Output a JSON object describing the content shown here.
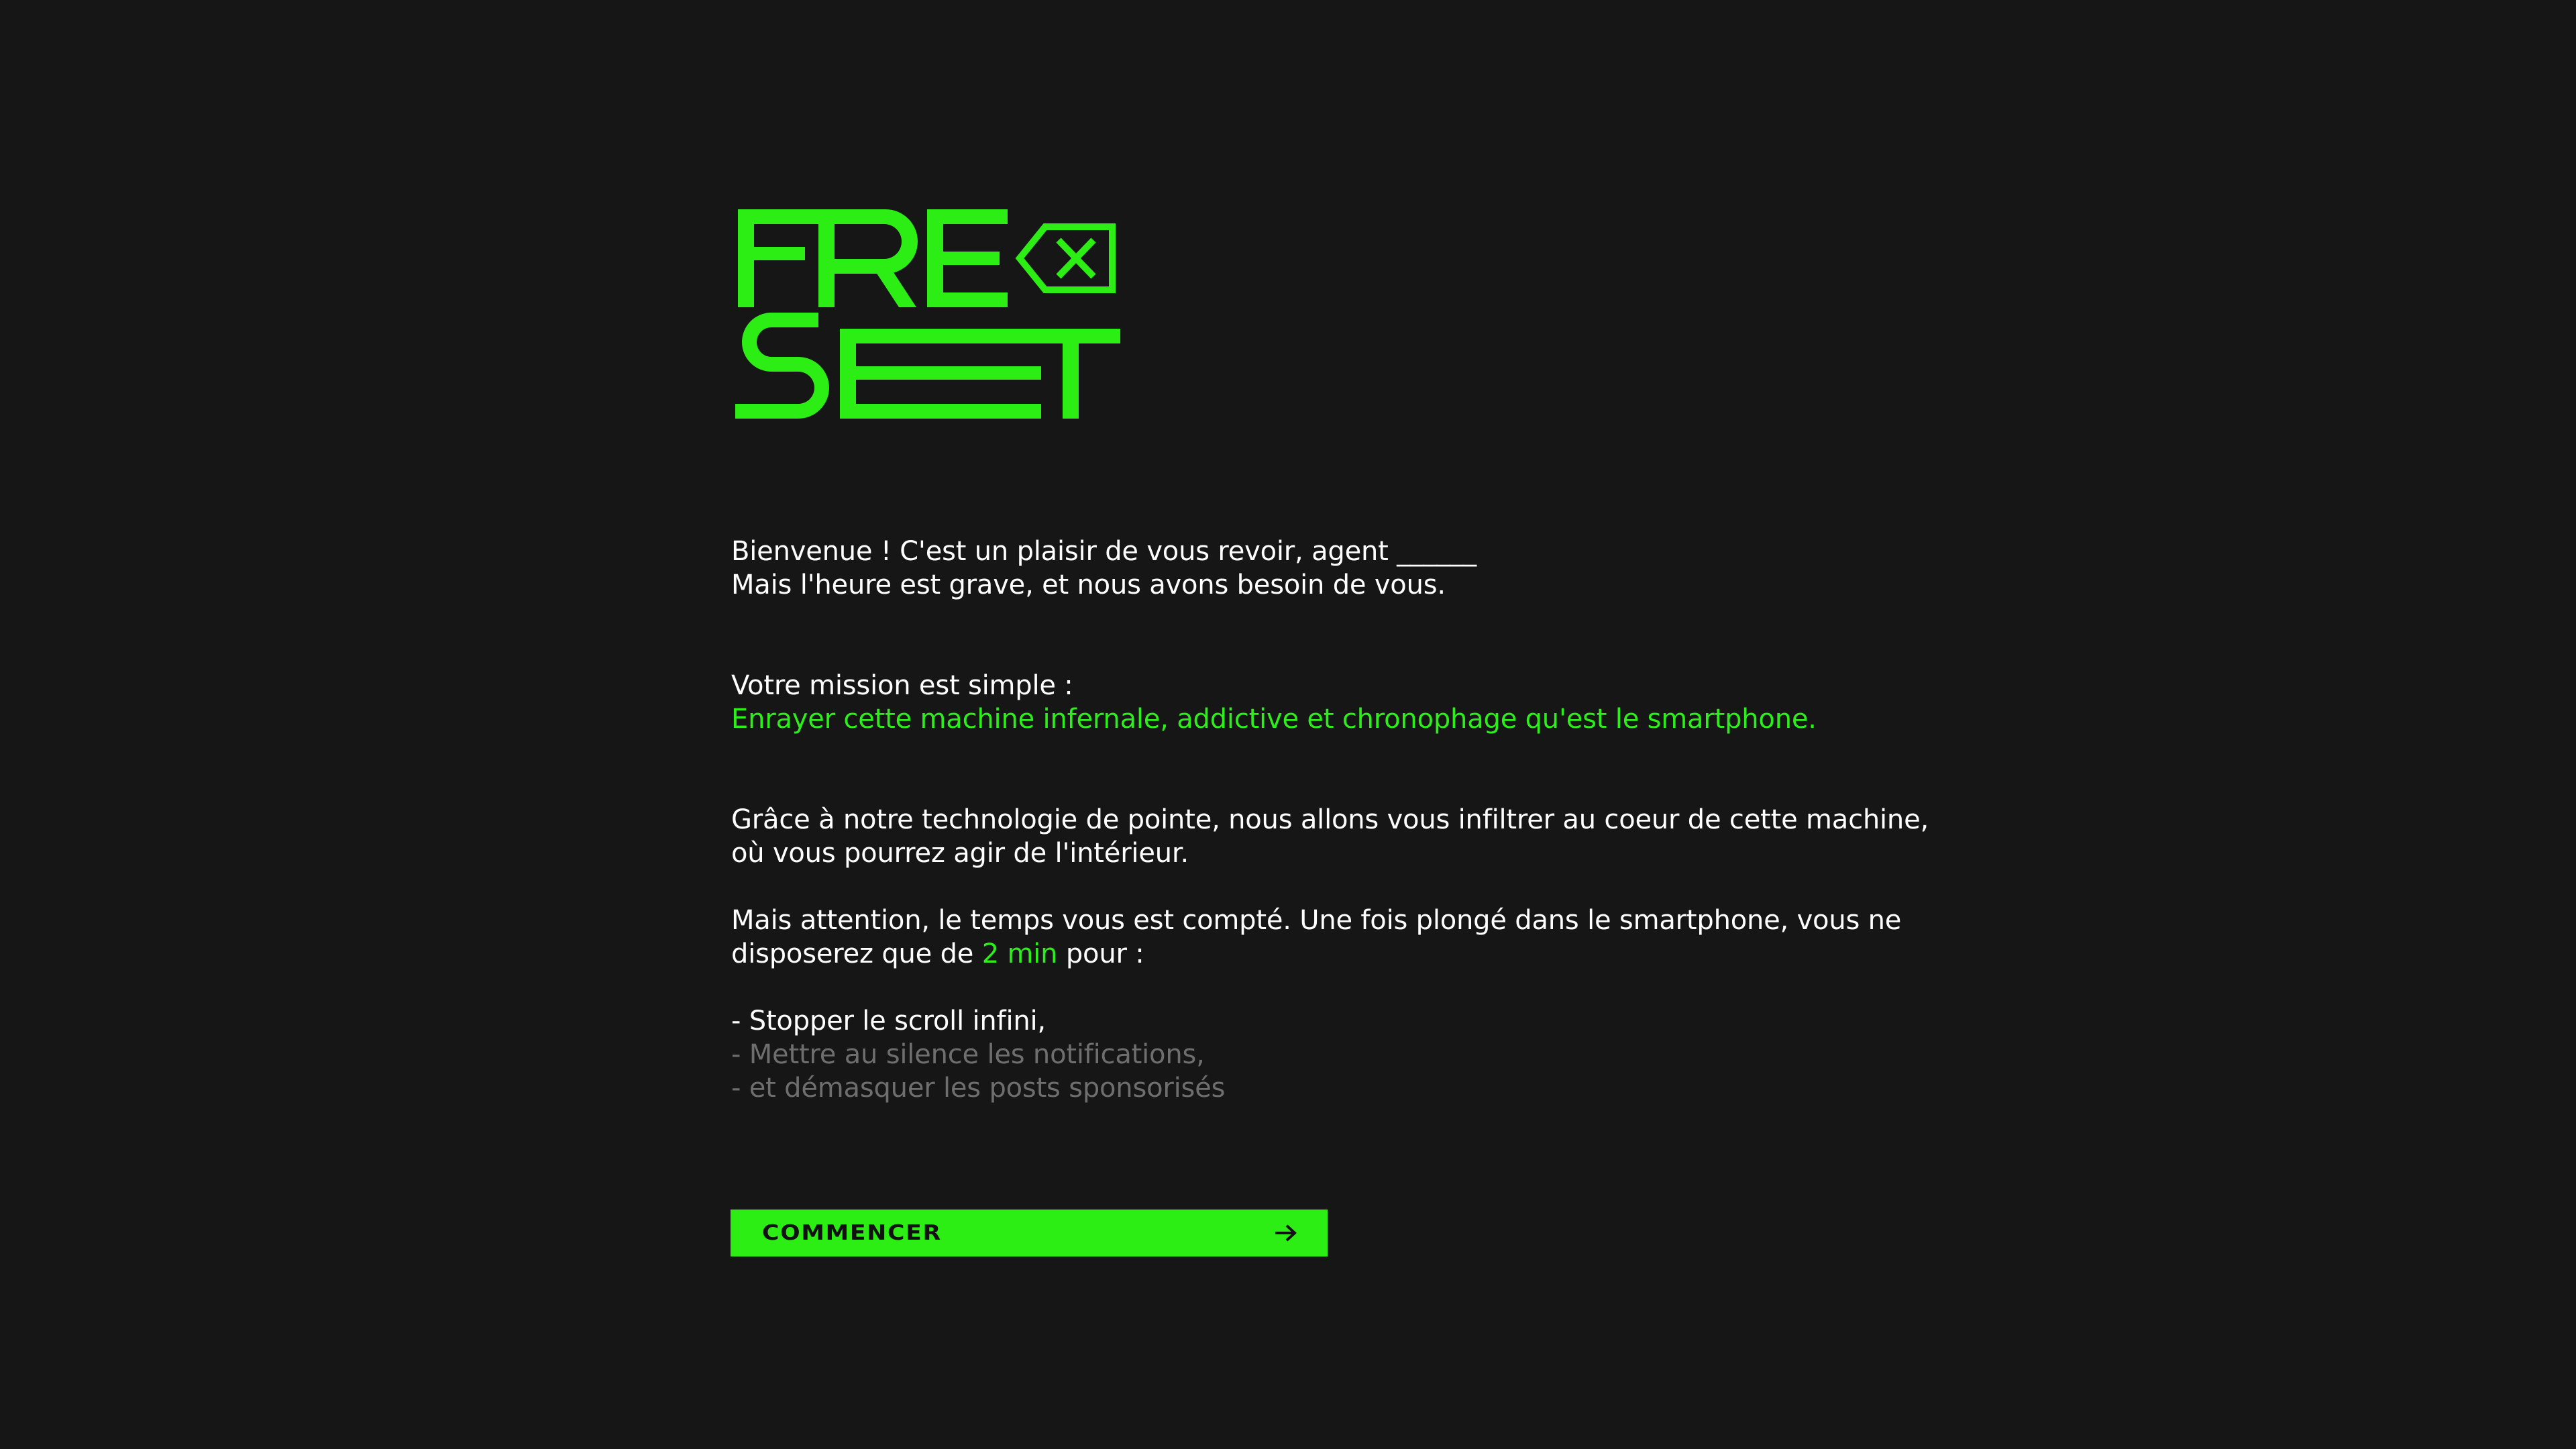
{
  "brand": {
    "logo_line1": "RE",
    "logo_line2": "SET",
    "logo_icon": "backspace-x-icon",
    "accent_color": "#2dee14"
  },
  "intro": {
    "line1": "Bienvenue ! C'est un plaisir de vous revoir, agent ______",
    "line2": "Mais l'heure est grave, et nous avons besoin de vous."
  },
  "mission": {
    "label": "Votre mission est simple :",
    "objective": "Enrayer cette machine infernale, addictive et chronophage qu'est le smartphone."
  },
  "infiltration": {
    "line1": "Grâce à notre technologie de pointe, nous allons vous infiltrer au coeur de cette machine,",
    "line2": "où vous pourrez agir de l'intérieur."
  },
  "warning": {
    "line1": "Mais attention, le temps vous est compté. Une fois plongé dans le smartphone, vous ne",
    "line2_before": "disposerez que de ",
    "line2_highlight": "2 min",
    "line2_after": " pour :"
  },
  "tasks": [
    {
      "text": "- Stopper le scroll infini,",
      "state": "active"
    },
    {
      "text": "- Mettre au silence les notifications,",
      "state": "locked"
    },
    {
      "text": "- et démasquer les posts sponsorisés",
      "state": "locked"
    }
  ],
  "cta": {
    "label": "COMMENCER",
    "icon": "arrow-right-icon"
  }
}
